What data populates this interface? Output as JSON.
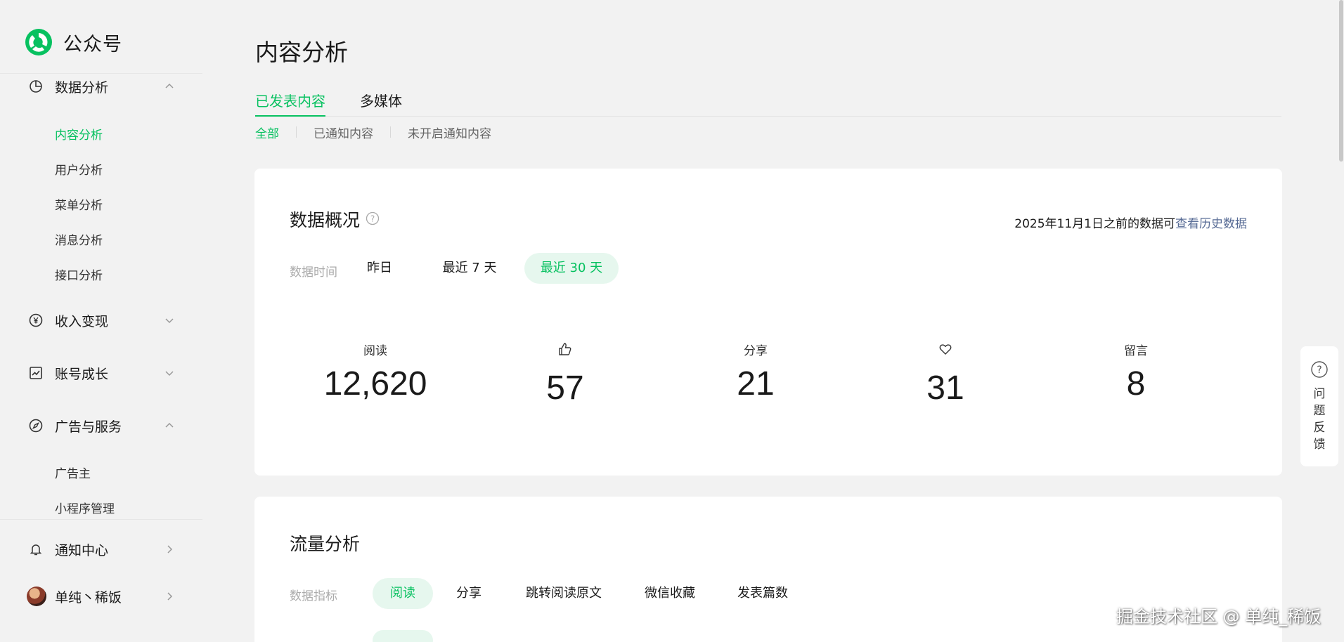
{
  "brand": {
    "name": "公众号",
    "color": "#07c160"
  },
  "sidebar": {
    "groups": [
      {
        "label": "数据分析",
        "icon": "pie-chart-icon",
        "expanded": true,
        "items": [
          "内容分析",
          "用户分析",
          "菜单分析",
          "消息分析",
          "接口分析"
        ],
        "active": "内容分析"
      },
      {
        "label": "收入变现",
        "icon": "yen-icon",
        "expanded": false
      },
      {
        "label": "账号成长",
        "icon": "trend-chart-icon",
        "expanded": false
      },
      {
        "label": "广告与服务",
        "icon": "compass-icon",
        "expanded": true,
        "items": [
          "广告主",
          "小程序管理"
        ]
      }
    ],
    "notification": "通知中心",
    "user": "单纯丶稀饭"
  },
  "page_title": "内容分析",
  "tabs": [
    "已发表内容",
    "多媒体"
  ],
  "subtabs": [
    "全部",
    "已通知内容",
    "未开启通知内容"
  ],
  "overview": {
    "title": "数据概况",
    "notice_text": "2025年11月1日之前的数据可",
    "notice_link": "查看历史数据",
    "time_label": "数据时间",
    "time_options": [
      "昨日",
      "最近 7 天",
      "最近 30 天"
    ],
    "time_selected": "最近 30 天",
    "stats": [
      {
        "label": "阅读",
        "value": "12,620"
      },
      {
        "icon": "thumbs-up-icon",
        "value": "57"
      },
      {
        "label": "分享",
        "value": "21"
      },
      {
        "icon": "heart-icon",
        "value": "31"
      },
      {
        "label": "留言",
        "value": "8"
      }
    ]
  },
  "traffic": {
    "title": "流量分析",
    "metric_label": "数据指标",
    "metrics": [
      "阅读",
      "分享",
      "跳转阅读原文",
      "微信收藏",
      "发表篇数"
    ],
    "metric_selected": "阅读"
  },
  "feedback": "问题反馈",
  "watermark": "掘金技术社区 @ 单纯_稀饭"
}
